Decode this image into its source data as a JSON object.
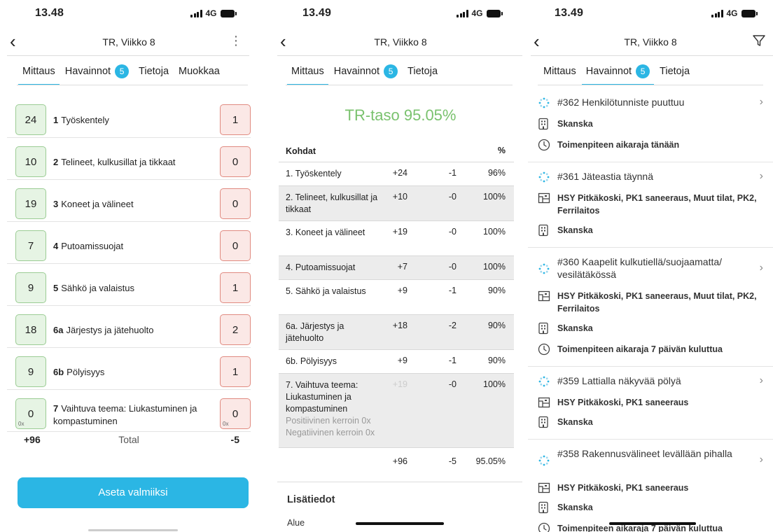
{
  "screen1": {
    "time": "13.48",
    "network": "4G",
    "title": "TR, Viikko 8",
    "tabs": [
      {
        "label": "Mittaus",
        "active": true
      },
      {
        "label": "Havainnot",
        "badge": "5"
      },
      {
        "label": "Tietoja"
      },
      {
        "label": "Muokkaa"
      }
    ],
    "rows": [
      {
        "pos": "24",
        "num": "1",
        "label": "Työskentely",
        "neg": "1"
      },
      {
        "pos": "10",
        "num": "2",
        "label": "Telineet, kulkusillat ja tikkaat",
        "neg": "0"
      },
      {
        "pos": "19",
        "num": "3",
        "label": "Koneet ja välineet",
        "neg": "0"
      },
      {
        "pos": "7",
        "num": "4",
        "label": "Putoamissuojat",
        "neg": "0"
      },
      {
        "pos": "9",
        "num": "5",
        "label": "Sähkö ja valaistus",
        "neg": "1"
      },
      {
        "pos": "18",
        "num": "6a",
        "label": "Järjestys ja jätehuolto",
        "neg": "2"
      },
      {
        "pos": "9",
        "num": "6b",
        "label": "Pölyisyys",
        "neg": "1"
      },
      {
        "pos": "0",
        "pos_mult": "0x",
        "num": "7",
        "label": "Vaihtuva teema: Liukastuminen ja kompastuminen",
        "neg": "0",
        "neg_mult": "0x"
      }
    ],
    "total_pos": "+96",
    "total_label": "Total",
    "total_neg": "-5",
    "cta": "Aseta valmiiksi"
  },
  "screen2": {
    "time": "13.49",
    "network": "4G",
    "title": "TR, Viikko 8",
    "tabs": [
      {
        "label": "Mittaus",
        "active": true
      },
      {
        "label": "Havainnot",
        "badge": "5"
      },
      {
        "label": "Tietoja"
      }
    ],
    "level": "TR-taso 95.05%",
    "table_header": {
      "col1": "Kohdat",
      "col4": "%"
    },
    "rows": [
      {
        "name": "1. Työskentely",
        "pos": "+24",
        "neg": "-1",
        "pct": "96%"
      },
      {
        "name": "2. Telineet, kulkusillat ja tikkaat",
        "pos": "+10",
        "neg": "-0",
        "pct": "100%"
      },
      {
        "name": "3. Koneet ja välineet",
        "pos": "+19",
        "neg": "-0",
        "pct": "100%"
      },
      {
        "name": "4. Putoamissuojat",
        "pos": "+7",
        "neg": "-0",
        "pct": "100%"
      },
      {
        "name": "5. Sähkö ja valaistus",
        "pos": "+9",
        "neg": "-1",
        "pct": "90%"
      },
      {
        "name": "6a. Järjestys ja jätehuolto",
        "pos": "+18",
        "neg": "-2",
        "pct": "90%"
      },
      {
        "name": "6b. Pölyisyys",
        "pos": "+9",
        "neg": "-1",
        "pct": "90%"
      },
      {
        "name": "7. Vaihtuva teema: Liukastuminen ja kompastuminen",
        "pos": "+19",
        "neg": "-0",
        "pct": "100%",
        "note1": "Positiivinen kerroin 0x",
        "note2": "Negatiivinen kerroin 0x"
      }
    ],
    "total": {
      "pos": "+96",
      "neg": "-5",
      "pct": "95.05%"
    },
    "section_title": "Lisätiedot",
    "area_label": "Alue"
  },
  "screen3": {
    "time": "13.49",
    "network": "4G",
    "title": "TR, Viikko 8",
    "tabs": [
      {
        "label": "Mittaus"
      },
      {
        "label": "Havainnot",
        "badge": "5",
        "active": true
      },
      {
        "label": "Tietoja"
      }
    ],
    "observations": [
      {
        "title": "#362 Henkilötunniste puuttuu",
        "company": "Skanska",
        "deadline": "Toimenpiteen aikaraja tänään"
      },
      {
        "title": "#361 Jäteastia täynnä",
        "location": "HSY Pitkäkoski, PK1 saneeraus, Muut tilat, PK2, Ferrilaitos",
        "company": "Skanska"
      },
      {
        "title": "#360 Kaapelit kulkutiellä/suojaamatta/ vesilätäkössä",
        "location": "HSY Pitkäkoski, PK1 saneeraus, Muut tilat, PK2, Ferrilaitos",
        "company": "Skanska",
        "deadline": "Toimenpiteen aikaraja 7 päivän kuluttua"
      },
      {
        "title": "#359 Lattialla näkyvää pölyä",
        "location": "HSY Pitkäkoski, PK1 saneeraus",
        "company": "Skanska"
      },
      {
        "title": "#358 Rakennusvälineet levällään pihalla",
        "location": "HSY Pitkäkoski, PK1 saneeraus",
        "company": "Skanska",
        "deadline": "Toimenpiteen aikaraja 7 päivän kuluttua"
      }
    ]
  },
  "colors": {
    "accent": "#2bb6e4",
    "positive": "#7ac26e",
    "negative_border": "#e08a80"
  }
}
